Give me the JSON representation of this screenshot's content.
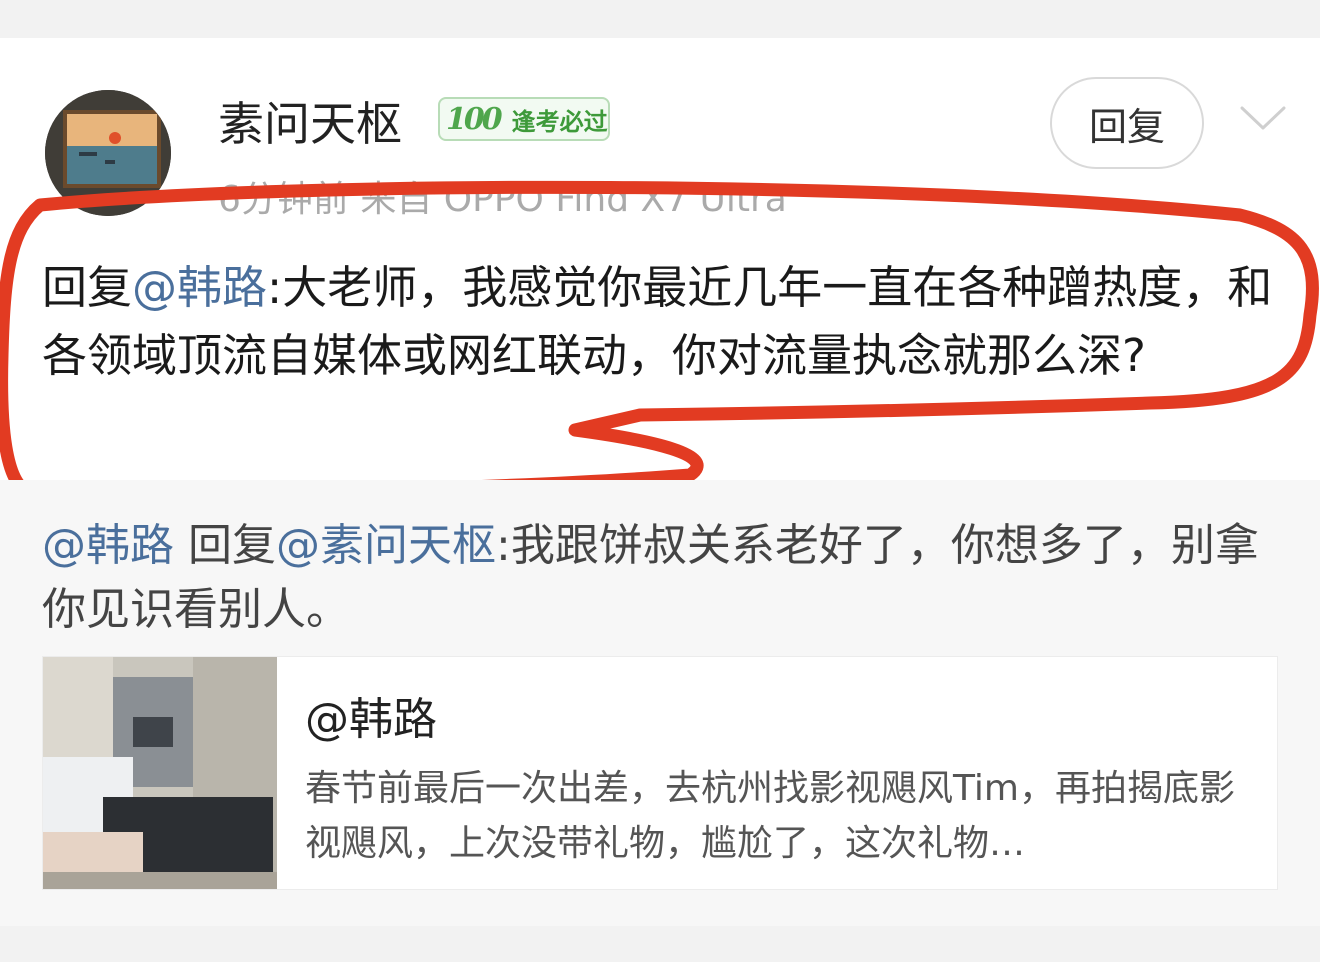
{
  "post": {
    "username": "素问天枢",
    "badge": {
      "number": "100",
      "label": "逢考必过"
    },
    "meta": "6分钟前  来自 OPPO Find X7 Ultra",
    "reply_button_label": "回复",
    "comment": {
      "prefix": "回复",
      "mention": "@韩路",
      "text": ":大老师，我感觉你最近几年一直在各种蹭热度，和各领域顶流自媒体或网红联动，你对流量执念就那么深?"
    }
  },
  "reply": {
    "author_mention": "@韩路",
    "reply_word": " 回复",
    "target_mention": "@素问天枢",
    "text": ":我跟饼叔关系老好了，你想多了，别拿你见识看别人。"
  },
  "quoted_card": {
    "author": "@韩路",
    "snippet": "春节前最后一次出差，去杭州找影视飓风Tim，再拍揭底影视飓风，上次没带礼物，尴尬了，这次礼物…"
  },
  "colors": {
    "mention": "#4a6f9c",
    "annotation_stroke": "#e23b22",
    "badge_green": "#4fa64c"
  },
  "icons": [
    "chevron-down-icon"
  ]
}
